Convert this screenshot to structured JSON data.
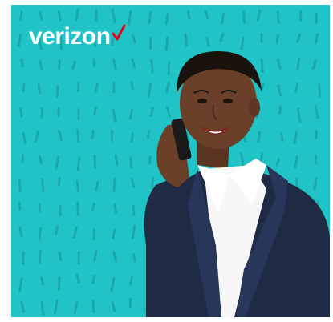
{
  "ad": {
    "brand_name": "verizon",
    "brand_check_icon": "checkmark-icon",
    "colors": {
      "background": "#20c4c6",
      "pattern_marks": "#18a9ab",
      "brand_text": "#ffffff",
      "brand_check": "#e8001c",
      "jacket": "#1f2a44",
      "shirt": "#f7f7f7",
      "skin": "#6b4028",
      "hair": "#1a120d",
      "phone": "#1a1a1a"
    },
    "photo_subject": "woman-on-phone-photo"
  }
}
